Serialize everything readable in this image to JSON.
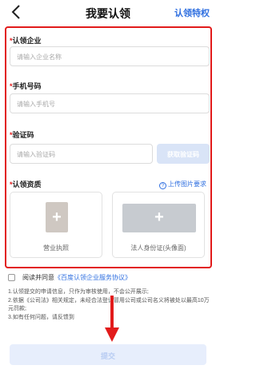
{
  "nav": {
    "title": "我要认领",
    "privilege_label": "认领特权"
  },
  "form": {
    "company": {
      "label": "认领企业",
      "placeholder": "请输入企业名称"
    },
    "phone": {
      "label": "手机号码",
      "placeholder": "请输入手机号"
    },
    "code": {
      "label": "验证码",
      "placeholder": "请输入验证码",
      "button": "获取验证码"
    },
    "qualification": {
      "label": "认领资质",
      "help_link": "上传图片要求",
      "cards": [
        {
          "caption": "营业执照"
        },
        {
          "caption": "法人身份证(头像面)"
        }
      ]
    },
    "required_mark": "*"
  },
  "agreement": {
    "prefix": "阅读并同意",
    "link": "《百度认领企业服务协议》"
  },
  "notes": [
    "1.认领提交的申请信息，只作为审核使用，不会公开展示;",
    "2.依据《公司法》相关规定，未经合法登记冒用公司或公司名义将被处以最高10万元罚款;",
    "3.如有任何问题，请反馈到"
  ],
  "submit_label": "提交",
  "colors": {
    "accent": "#2f6fe0",
    "highlight_frame": "#e21b1b",
    "button_disabled": "#d9e4f7"
  }
}
